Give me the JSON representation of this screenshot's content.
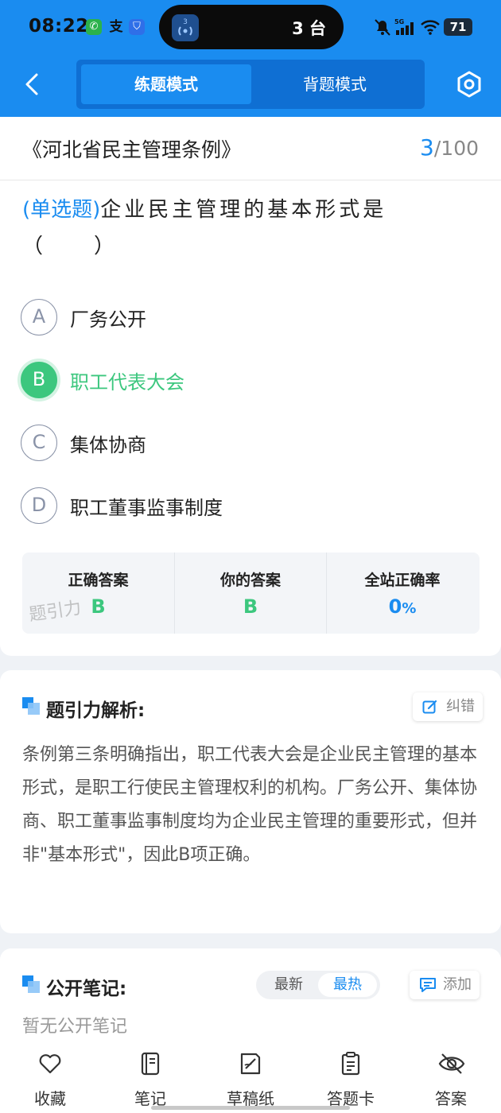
{
  "status_bar": {
    "time": "08:22",
    "island_text": "3 台",
    "island_badge": "3",
    "network": "5G",
    "battery": "71"
  },
  "header": {
    "modes": [
      "练题模式",
      "背题模式"
    ],
    "active_mode": "练题模式"
  },
  "question_card": {
    "doc_title": "《河北省民主管理条例》",
    "current": "3",
    "total": "/100",
    "question_type": "(单选题)",
    "question_text": "企业民主管理的基本形式是（　　）",
    "options": [
      {
        "letter": "A",
        "text": "厂务公开"
      },
      {
        "letter": "B",
        "text": "职工代表大会"
      },
      {
        "letter": "C",
        "text": "集体协商"
      },
      {
        "letter": "D",
        "text": "职工董事监事制度"
      }
    ],
    "answers": {
      "correct_label": "正确答案",
      "correct_value": "B",
      "yours_label": "你的答案",
      "yours_value": "B",
      "rate_label": "全站正确率",
      "rate_value": "0",
      "rate_unit": "%",
      "watermark": "题引力"
    }
  },
  "analysis": {
    "title": "题引力解析:",
    "report_label": "纠错",
    "text": "条例第三条明确指出，职工代表大会是企业民主管理的基本形式，是职工行使民主管理权利的机构。厂务公开、集体协商、职工董事监事制度均为企业民主管理的重要形式，但并非\"基本形式\"，因此B项正确。"
  },
  "notes": {
    "title": "公开笔记:",
    "sort_options": [
      "最新",
      "最热"
    ],
    "sort_selected": "最热",
    "add_label": "添加",
    "empty_text": "暂无公开笔记"
  },
  "bottom_nav": [
    {
      "label": "收藏",
      "icon": "heart-icon"
    },
    {
      "label": "笔记",
      "icon": "notebook-icon"
    },
    {
      "label": "草稿纸",
      "icon": "draft-paper-icon"
    },
    {
      "label": "答题卡",
      "icon": "answer-sheet-icon"
    },
    {
      "label": "答案",
      "icon": "eye-off-icon"
    }
  ],
  "colors": {
    "primary": "#1a8cf0",
    "correct": "#3cc77e",
    "background": "#eff2f6"
  }
}
